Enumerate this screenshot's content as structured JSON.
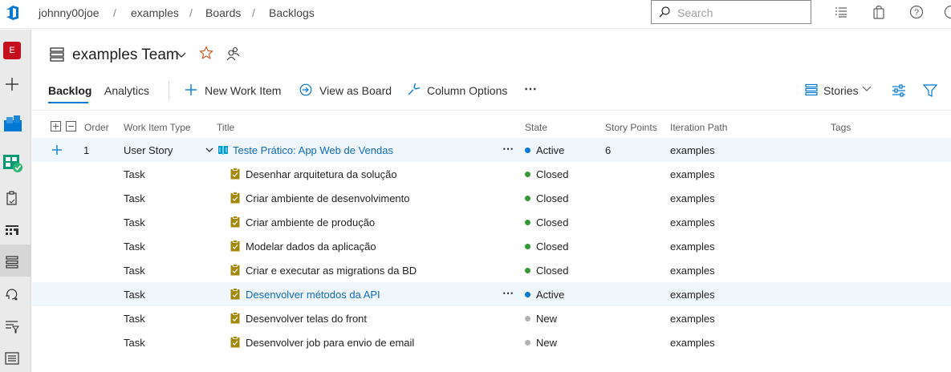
{
  "breadcrumb": {
    "org": "johnny00joe",
    "project": "examples",
    "hub": "Boards",
    "page": "Backlogs",
    "separator": "/"
  },
  "search": {
    "placeholder": "Search"
  },
  "leftnav": {
    "project_initial": "E"
  },
  "team": {
    "name": "examples Team"
  },
  "tabs": [
    {
      "label": "Backlog"
    },
    {
      "label": "Analytics"
    }
  ],
  "commands": {
    "new_work_item": "New Work Item",
    "view_as_board": "View as Board",
    "column_options": "Column Options",
    "more": "⋯",
    "backlog_level": "Stories"
  },
  "columns": {
    "order": "Order",
    "work_item_type": "Work Item Type",
    "title": "Title",
    "state": "State",
    "story_points": "Story Points",
    "iteration_path": "Iteration Path",
    "tags": "Tags"
  },
  "rows": [
    {
      "order": "1",
      "type": "User Story",
      "title": "Teste Prático: App Web de Vendas",
      "state": "Active",
      "state_color": "#0078d4",
      "points": "6",
      "iteration": "examples",
      "more": "⋯"
    },
    {
      "type": "Task",
      "title": "Desenhar arquitetura da solução",
      "state": "Closed",
      "state_color": "#339933",
      "iteration": "examples"
    },
    {
      "type": "Task",
      "title": "Criar ambiente de desenvolvimento",
      "state": "Closed",
      "state_color": "#339933",
      "iteration": "examples"
    },
    {
      "type": "Task",
      "title": "Criar ambiente de produção",
      "state": "Closed",
      "state_color": "#339933",
      "iteration": "examples"
    },
    {
      "type": "Task",
      "title": "Modelar dados da aplicação",
      "state": "Closed",
      "state_color": "#339933",
      "iteration": "examples"
    },
    {
      "type": "Task",
      "title": "Criar e executar as migrations da BD",
      "state": "Closed",
      "state_color": "#339933",
      "iteration": "examples"
    },
    {
      "type": "Task",
      "title": "Desenvolver métodos da API",
      "state": "Active",
      "state_color": "#0078d4",
      "iteration": "examples",
      "more": "⋯"
    },
    {
      "type": "Task",
      "title": "Desenvolver telas do front",
      "state": "New",
      "state_color": "#b2b2b2",
      "iteration": "examples"
    },
    {
      "type": "Task",
      "title": "Desenvolver job para envio de email",
      "state": "New",
      "state_color": "#b2b2b2",
      "iteration": "examples"
    }
  ],
  "colors": {
    "accent": "#0078d4",
    "story_icon": "#009ccc",
    "task_icon": "#a4880a",
    "closed": "#339933",
    "new": "#b2b2b2"
  }
}
